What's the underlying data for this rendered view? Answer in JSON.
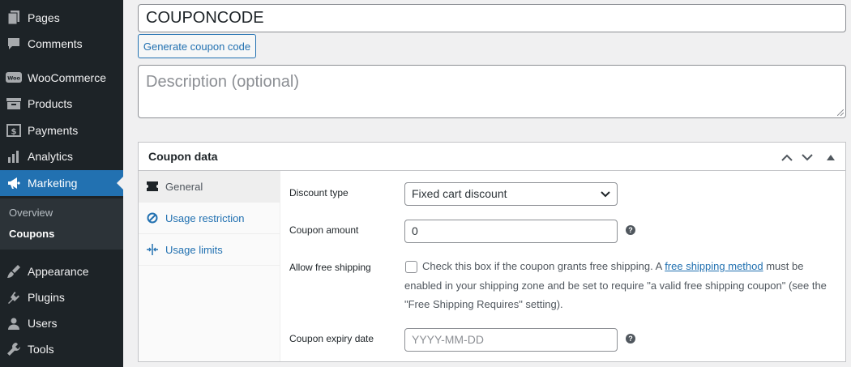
{
  "sidebar": {
    "items": [
      {
        "label": "Pages",
        "icon": "pages-icon"
      },
      {
        "label": "Comments",
        "icon": "comments-icon"
      },
      {
        "label": "WooCommerce",
        "icon": "woocommerce-icon"
      },
      {
        "label": "Products",
        "icon": "products-icon"
      },
      {
        "label": "Payments",
        "icon": "payments-icon"
      },
      {
        "label": "Analytics",
        "icon": "analytics-icon"
      },
      {
        "label": "Marketing",
        "icon": "megaphone-icon"
      },
      {
        "label": "Appearance",
        "icon": "appearance-icon"
      },
      {
        "label": "Plugins",
        "icon": "plugins-icon"
      },
      {
        "label": "Users",
        "icon": "users-icon"
      },
      {
        "label": "Tools",
        "icon": "tools-icon"
      }
    ],
    "submenu": [
      {
        "label": "Overview"
      },
      {
        "label": "Coupons"
      }
    ]
  },
  "coupon": {
    "code": "COUPONCODE",
    "generate_label": "Generate coupon code",
    "description_placeholder": "Description (optional)"
  },
  "panel": {
    "title": "Coupon data",
    "tabs": [
      {
        "label": "General",
        "icon": "ticket-icon"
      },
      {
        "label": "Usage restriction",
        "icon": "block-icon"
      },
      {
        "label": "Usage limits",
        "icon": "limits-icon"
      }
    ],
    "fields": {
      "discount_type_label": "Discount type",
      "discount_type_value": "Fixed cart discount",
      "amount_label": "Coupon amount",
      "amount_value": "0",
      "free_shipping_label": "Allow free shipping",
      "free_shipping_text_before": "Check this box if the coupon grants free shipping. A ",
      "free_shipping_link": "free shipping method",
      "free_shipping_text_after": " must be enabled in your shipping zone and be set to require \"a valid free shipping coupon\" (see the \"Free Shipping Requires\" setting).",
      "expiry_label": "Coupon expiry date",
      "expiry_placeholder": "YYYY-MM-DD"
    }
  },
  "colors": {
    "sidebar_bg": "#1d2327",
    "accent": "#2271b1",
    "page_bg": "#f0f0f1"
  }
}
